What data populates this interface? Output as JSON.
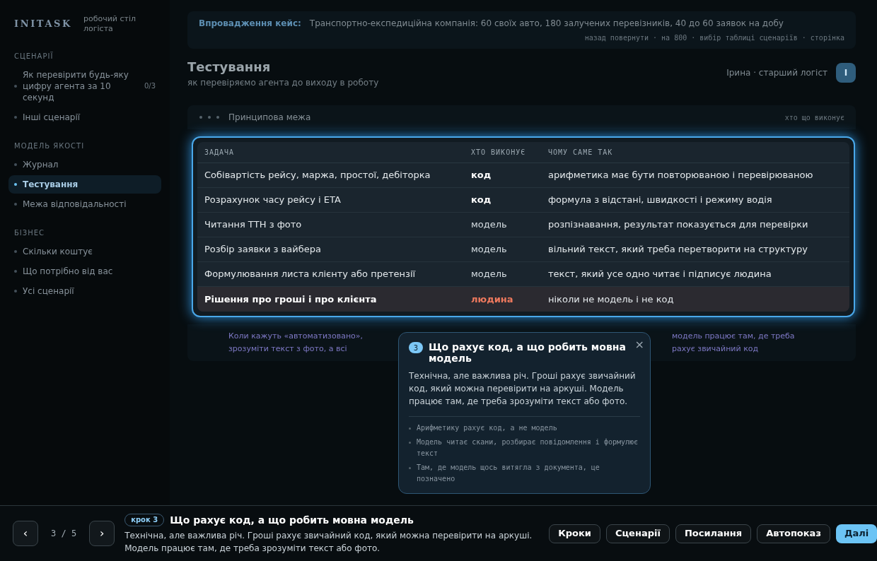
{
  "sidebar": {
    "logo": "INITASK",
    "subtitle": "робочий стіл логіста",
    "sections": [
      {
        "title": "СЦЕНАРІЇ",
        "items": [
          {
            "label": "Як перевірити будь-яку цифру агента за 10 секунд",
            "count": "0/3",
            "selected": false
          },
          {
            "label": "Інші сценарії",
            "selected": false
          }
        ]
      },
      {
        "title": "МОДЕЛЬ ЯКОСТІ",
        "items": [
          {
            "label": "Журнал",
            "selected": false
          },
          {
            "label": "Тестування",
            "selected": true
          },
          {
            "label": "Межа відповідальності",
            "selected": false
          }
        ]
      },
      {
        "title": "БІЗНЕС",
        "items": [
          {
            "label": "Скільки коштує",
            "selected": false
          },
          {
            "label": "Що потрібно від вас",
            "selected": false
          },
          {
            "label": "Усі сценарії",
            "selected": false
          }
        ]
      }
    ]
  },
  "case_banner": {
    "label": "Впровадження кейс:",
    "text": "Транспортно-експедиційна компанія: 60 своїх авто, 180 залучених перевізників, 40 до 60 заявок на добу",
    "links": "назад повернути · на 800 · вибір таблиці сценаріїв · сторінка"
  },
  "page": {
    "title": "Тестування",
    "subtitle": "як перевіряємо агента до виходу в роботу",
    "user": "Ірина · старший логіст",
    "avatar": "І"
  },
  "section": {
    "title": "Принципова межа",
    "hint": "хто що виконує"
  },
  "table": {
    "columns": [
      "ЗАДАЧА",
      "ХТО ВИКОНУЄ",
      "ЧОМУ САМЕ ТАК"
    ],
    "rows": [
      {
        "task": "Собівартість рейсу, маржа, простої, дебіторка",
        "executor": "код",
        "kind": "code",
        "reason": "арифметика має бути повторюваною і перевірюваною"
      },
      {
        "task": "Розрахунок часу рейсу і ETA",
        "executor": "код",
        "kind": "code",
        "reason": "формула з відстані, швидкості і режиму водія"
      },
      {
        "task": "Читання ТТН з фото",
        "executor": "модель",
        "kind": "model",
        "reason": "розпізнавання, результат показується для перевірки"
      },
      {
        "task": "Розбір заявки з вайбера",
        "executor": "модель",
        "kind": "model",
        "reason": "вільний текст, який треба перетворити на структуру"
      },
      {
        "task": "Формулювання листа клієнту або претензії",
        "executor": "модель",
        "kind": "model",
        "reason": "текст, який усе одно читає і підписує людина"
      },
      {
        "task": "Рішення про гроші і про клієнта",
        "executor": "людина",
        "kind": "human",
        "reason": "ніколи не модель і не код"
      }
    ]
  },
  "note": {
    "left": [
      "Коли кажуть «автоматизовано»,",
      "зрозуміти текст з фото, а всі"
    ],
    "right": [
      "модель працює там, де треба",
      "рахує звичайний код"
    ]
  },
  "tour_popover": {
    "step": "3",
    "close": "×",
    "title": "Що рахує код, а що робить мовна модель",
    "text": "Технічна, але важлива річ. Гроші рахує звичайний код, який можна перевірити на аркуші. Модель працює там, де треба зрозуміти текст або фото.",
    "bullets": [
      "Арифметику рахує код, а не модель",
      "Модель читає скани, розбирає повідомлення і формулює текст",
      "Там, де модель щось витягла з документа, це позначено"
    ]
  },
  "tour_bar": {
    "prev": "‹",
    "counter": "3 / 5",
    "next": "›",
    "step_badge": "крок 3",
    "title": "Що рахує код, а що робить мовна модель",
    "text": "Технічна, але важлива річ. Гроші рахує звичайний код, який можна перевірити на аркуші. Модель працює там, де треба зрозуміти текст або фото.",
    "buttons": [
      {
        "label": "Кроки",
        "primary": false
      },
      {
        "label": "Сценарії",
        "primary": false
      },
      {
        "label": "Посилання",
        "primary": false
      },
      {
        "label": "Автопоказ",
        "primary": false
      },
      {
        "label": "Далі",
        "primary": true
      }
    ]
  }
}
